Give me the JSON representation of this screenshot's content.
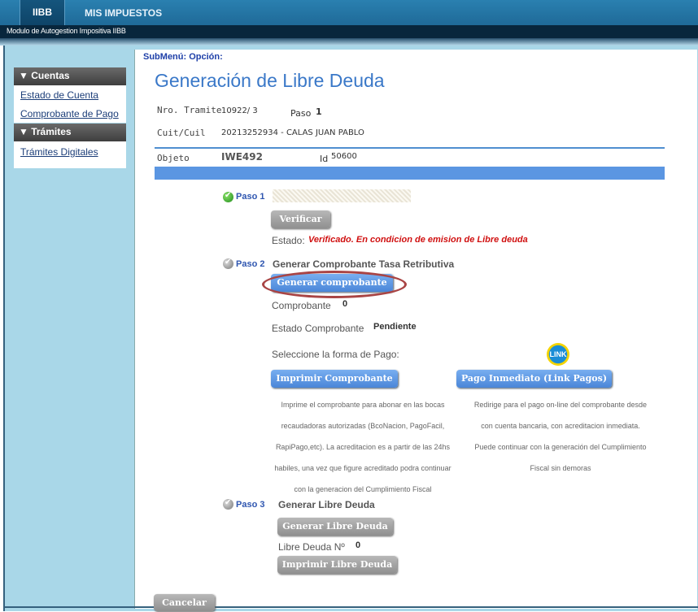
{
  "header": {
    "tab_active": "IIBB",
    "tab_other": "MIS IMPUESTOS",
    "module_title": "Modulo de Autogestion Impositiva IIBB"
  },
  "sidebar": {
    "section1": "▼ Cuentas",
    "section1_items": [
      "Estado de Cuenta",
      "Comprobante de Pago"
    ],
    "section2": "▼ Trámites",
    "section2_items": [
      "Trámites Digitales"
    ]
  },
  "submenu": "SubMenú: Opción:",
  "page_title": "Generación de Libre Deuda",
  "info": {
    "tramite_label": "Nro. Tramite",
    "tramite_value": "10922/ 3",
    "paso_label": "Paso",
    "paso_value": "1",
    "cuit_label": "Cuit/Cuil",
    "cuit_value": "20213252934 - CALAS JUAN PABLO",
    "objeto_label": "Objeto",
    "objeto_value": "IWE492",
    "id_label": "Id",
    "id_value": "50600"
  },
  "paso1": {
    "label": "Paso 1",
    "button": "Verificar",
    "estado_label": "Estado:",
    "estado_value": "Verificado. En condicion de emision de Libre deuda"
  },
  "paso2": {
    "label": "Paso 2",
    "title": "Generar Comprobante Tasa Retributiva",
    "button": "Generar comprobante",
    "comprobante_label": "Comprobante",
    "comprobante_value": "0",
    "estado_label": "Estado Comprobante",
    "estado_value": "Pendiente",
    "pago_label": "Seleccione la forma de Pago:",
    "link_logo": "LINK",
    "print_button": "Imprimir Comprobante",
    "link_button": "Pago Inmediato (Link Pagos)",
    "print_desc": [
      "Imprime el comprobante para abonar en las bocas",
      "recaudadoras autorizadas (BcoNacion, PagoFacil,",
      "RapiPago,etc). La acreditacion es a partir de las 24hs",
      "habiles, una vez que figure acreditado podra continuar",
      "con la generacion del Cumplimiento Fiscal"
    ],
    "link_desc": [
      "Redirige para el pago on-line del comprobante desde",
      "con cuenta bancaria, con acreditacion inmediata.",
      "Puede continuar con la generación del Cumplimiento",
      "Fiscal sin demoras"
    ]
  },
  "paso3": {
    "label": "Paso 3",
    "title": "Generar Libre Deuda",
    "button": "Generar Libre Deuda",
    "libre_label": "Libre Deuda Nº",
    "libre_value": "0",
    "print_button": "Imprimir Libre Deuda"
  },
  "cancel_button": "Cancelar"
}
